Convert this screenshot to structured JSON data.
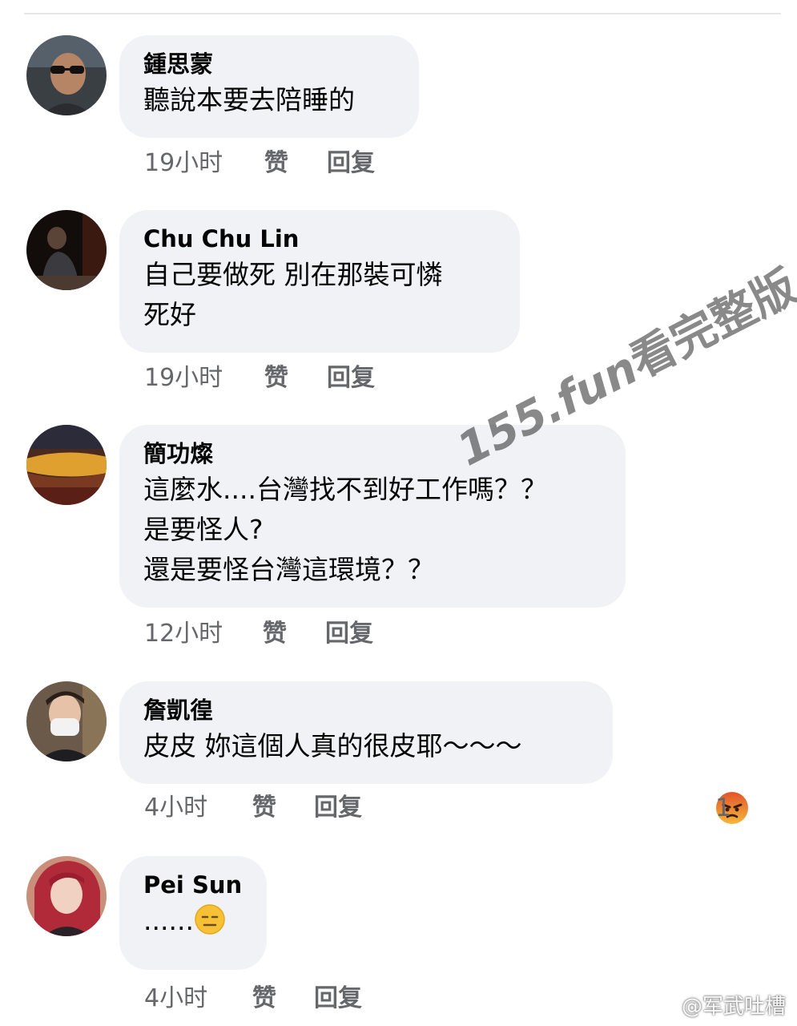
{
  "comments": [
    {
      "author": "鍾思蒙",
      "lines": [
        "聽說本要去陪睡的"
      ],
      "time": "19小时",
      "like": "赞",
      "reply": "回复"
    },
    {
      "author": "Chu Chu Lin",
      "lines": [
        "自己要做死 別在那裝可憐",
        "死好"
      ],
      "time": "19小时",
      "like": "赞",
      "reply": "回复"
    },
    {
      "author": "簡功燦",
      "lines": [
        "這麼水....台灣找不到好工作嗎？？",
        "是要怪人?",
        "還是要怪台灣這環境？？"
      ],
      "time": "12小时",
      "like": "赞",
      "reply": "回复"
    },
    {
      "author": "詹凱徨",
      "lines": [
        "皮皮 妳這個人真的很皮耶～～～"
      ],
      "time": "4小时",
      "like": "赞",
      "reply": "回复",
      "reaction": {
        "count": "1",
        "icon": "angry-reaction-icon",
        "color": "#e9710f"
      }
    },
    {
      "author": "Pei Sun",
      "lines": [
        "......"
      ],
      "time": "4小时",
      "like": "赞",
      "reply": "回复",
      "emoji": "expressionless-face-icon"
    }
  ],
  "watermark": {
    "site": "155.fun",
    "suffix": "看完整版"
  },
  "source_mark": {
    "text": "@军武吐槽",
    "icon": "weibo-icon"
  },
  "colors": {
    "bubble": "#f0f2f5",
    "meta_text": "#65676b",
    "body_text": "#050505"
  }
}
